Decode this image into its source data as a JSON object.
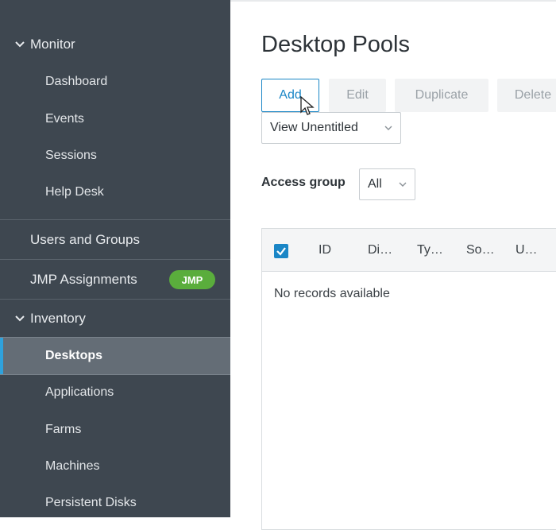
{
  "sidebar": {
    "monitor": {
      "label": "Monitor",
      "items": [
        "Dashboard",
        "Events",
        "Sessions",
        "Help Desk"
      ]
    },
    "users_groups": "Users and Groups",
    "jmp_assignments": "JMP Assignments",
    "jmp_badge": "JMP",
    "inventory": {
      "label": "Inventory",
      "active": "Desktops",
      "items": [
        "Applications",
        "Farms",
        "Machines",
        "Persistent Disks"
      ]
    }
  },
  "main": {
    "title": "Desktop Pools",
    "buttons": {
      "add": "Add",
      "edit": "Edit",
      "duplicate": "Duplicate",
      "delete": "Delete"
    },
    "view_select": "View Unentitled",
    "access_group_label": "Access group",
    "access_group_value": "All",
    "columns": [
      "ID",
      "Di…",
      "Ty…",
      "So…",
      "U…"
    ],
    "empty_message": "No records available"
  },
  "colors": {
    "sidebar_bg": "#3e4750",
    "accent": "#1a86c6",
    "badge_green": "#5aad3c",
    "active_row": "#646d76"
  },
  "icons": {
    "expand": "chevron-down-icon",
    "checkbox": "checkbox-checked-icon",
    "cursor": "mouse-pointer-icon"
  }
}
